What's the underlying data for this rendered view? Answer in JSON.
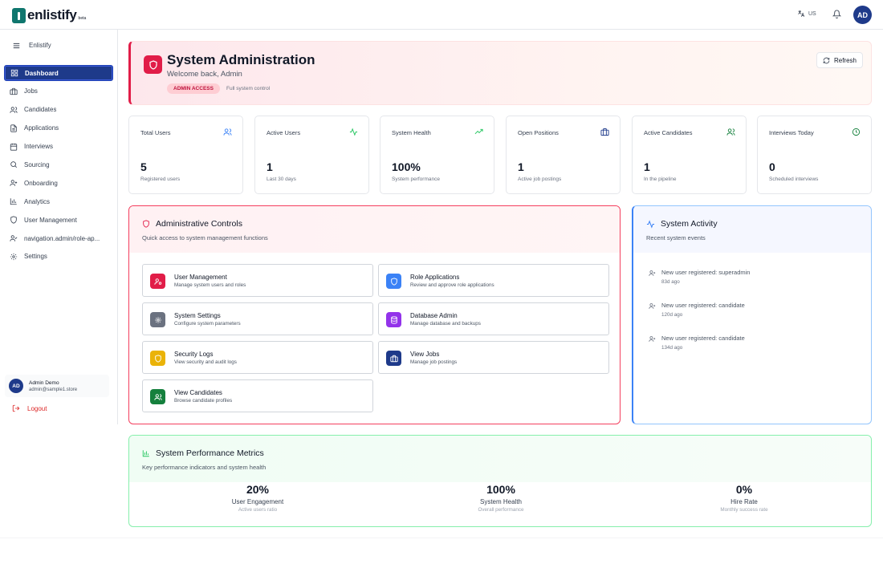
{
  "brand": {
    "name": "enlistify",
    "suffix": "beta"
  },
  "topbar": {
    "language": "US",
    "user_initials": "AD"
  },
  "sidebar": {
    "header": "Enlistify",
    "items": [
      {
        "label": "Dashboard",
        "icon": "dashboard-icon",
        "active": true
      },
      {
        "label": "Jobs",
        "icon": "briefcase-icon"
      },
      {
        "label": "Candidates",
        "icon": "users-icon"
      },
      {
        "label": "Applications",
        "icon": "file-text-icon"
      },
      {
        "label": "Interviews",
        "icon": "calendar-icon"
      },
      {
        "label": "Sourcing",
        "icon": "search-icon"
      },
      {
        "label": "Onboarding",
        "icon": "user-plus-icon"
      },
      {
        "label": "Analytics",
        "icon": "bar-chart-icon"
      },
      {
        "label": "User Management",
        "icon": "shield-icon"
      },
      {
        "label": "navigation.admin/role-ap...",
        "icon": "user-check-icon"
      },
      {
        "label": "Settings",
        "icon": "gear-icon"
      }
    ],
    "user": {
      "initials": "AD",
      "name": "Admin Demo",
      "email": "admin@sample1.store"
    },
    "logout_label": "Logout"
  },
  "hero": {
    "title": "System Administration",
    "subtitle": "Welcome back, Admin",
    "badge": "ADMIN ACCESS",
    "badge_note": "Full system control",
    "refresh_label": "Refresh",
    "accent_color": "#e11d48"
  },
  "stats": [
    {
      "label": "Total Users",
      "value": "5",
      "desc": "Registered users",
      "icon": "users-icon",
      "color": "#3b82f6"
    },
    {
      "label": "Active Users",
      "value": "1",
      "desc": "Last 30 days",
      "icon": "activity-icon",
      "color": "#22c55e"
    },
    {
      "label": "System Health",
      "value": "100%",
      "desc": "System performance",
      "icon": "trending-up-icon",
      "color": "#22c55e"
    },
    {
      "label": "Open Positions",
      "value": "1",
      "desc": "Active job postings",
      "icon": "briefcase-icon",
      "color": "#1e3a8a"
    },
    {
      "label": "Active Candidates",
      "value": "1",
      "desc": "In the pipeline",
      "icon": "users-icon",
      "color": "#15803d"
    },
    {
      "label": "Interviews Today",
      "value": "0",
      "desc": "Scheduled interviews",
      "icon": "clock-icon",
      "color": "#15803d"
    }
  ],
  "admin_controls": {
    "title": "Administrative Controls",
    "subtitle": "Quick access to system management functions",
    "items": [
      {
        "title": "User Management",
        "desc": "Manage system users and roles",
        "icon": "user-cog-icon",
        "color": "#e11d48"
      },
      {
        "title": "Role Applications",
        "desc": "Review and approve role applications",
        "icon": "shield-icon",
        "color": "#3b82f6"
      },
      {
        "title": "System Settings",
        "desc": "Configure system parameters",
        "icon": "gear-icon",
        "color": "#6b7280"
      },
      {
        "title": "Database Admin",
        "desc": "Manage database and backups",
        "icon": "database-icon",
        "color": "#9333ea"
      },
      {
        "title": "Security Logs",
        "desc": "View security and audit logs",
        "icon": "shield-icon",
        "color": "#eab308"
      },
      {
        "title": "View Jobs",
        "desc": "Manage job postings",
        "icon": "briefcase-icon",
        "color": "#1e3a8a"
      },
      {
        "title": "View Candidates",
        "desc": "Browse candidate profiles",
        "icon": "users-icon",
        "color": "#15803d"
      }
    ]
  },
  "activity": {
    "title": "System Activity",
    "subtitle": "Recent system events",
    "items": [
      {
        "text": "New user registered: superadmin",
        "time": "83d ago"
      },
      {
        "text": "New user registered: candidate",
        "time": "120d ago"
      },
      {
        "text": "New user registered: candidate",
        "time": "134d ago"
      }
    ]
  },
  "metrics": {
    "title": "System Performance Metrics",
    "subtitle": "Key performance indicators and system health",
    "items": [
      {
        "value": "20%",
        "label": "User Engagement",
        "desc": "Active users ratio"
      },
      {
        "value": "100%",
        "label": "System Health",
        "desc": "Overall performance"
      },
      {
        "value": "0%",
        "label": "Hire Rate",
        "desc": "Monthly success rate"
      }
    ]
  }
}
